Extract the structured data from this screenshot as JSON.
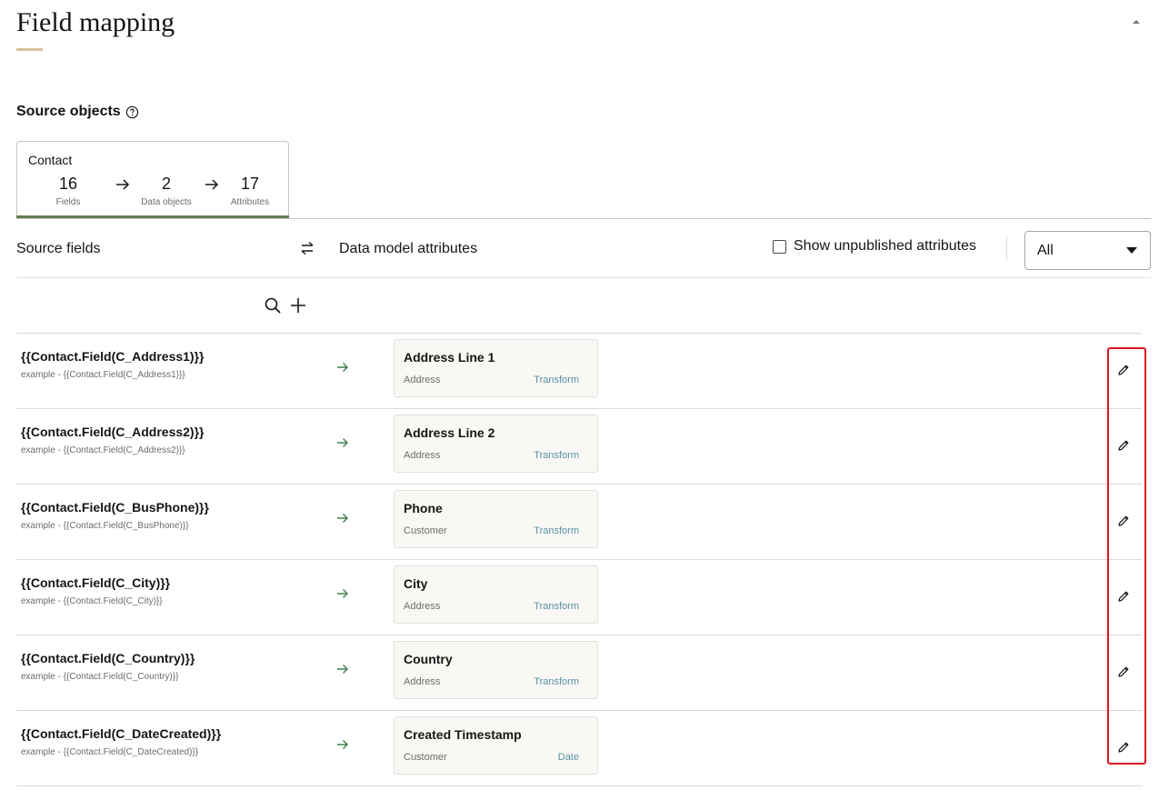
{
  "page": {
    "title": "Field mapping",
    "collapse_icon": "caret-up-icon"
  },
  "source_objects": {
    "heading": "Source objects",
    "help_icon": "help-circle-icon",
    "card": {
      "title": "Contact",
      "fields_count": "16",
      "fields_label": "Fields",
      "data_objects_count": "2",
      "data_objects_label": "Data objects",
      "attributes_count": "17",
      "attributes_label": "Attributes"
    }
  },
  "mapping_header": {
    "source_fields": "Source fields",
    "swap_icon": "swap-arrows-icon",
    "data_model_attributes": "Data model attributes",
    "show_unpublished_label": "Show unpublished attributes",
    "show_unpublished_checked": false,
    "filter_selected": "All"
  },
  "toolbar": {
    "search_icon": "search-icon",
    "add_icon": "plus-icon"
  },
  "rows": [
    {
      "field": "{{Contact.Field(C_Address1)}}",
      "example": "example - {{Contact.Field(C_Address1)}}",
      "attribute": "Address Line 1",
      "object": "Address",
      "action": "Transform"
    },
    {
      "field": "{{Contact.Field(C_Address2)}}",
      "example": "example - {{Contact.Field(C_Address2)}}",
      "attribute": "Address Line 2",
      "object": "Address",
      "action": "Transform"
    },
    {
      "field": "{{Contact.Field(C_BusPhone)}}",
      "example": "example - {{Contact.Field(C_BusPhone)}}",
      "attribute": "Phone",
      "object": "Customer",
      "action": "Transform"
    },
    {
      "field": "{{Contact.Field(C_City)}}",
      "example": "example - {{Contact.Field(C_City)}}",
      "attribute": "City",
      "object": "Address",
      "action": "Transform"
    },
    {
      "field": "{{Contact.Field(C_Country)}}",
      "example": "example - {{Contact.Field(C_Country)}}",
      "attribute": "Country",
      "object": "Address",
      "action": "Transform"
    },
    {
      "field": "{{Contact.Field(C_DateCreated)}}",
      "example": "example - {{Contact.Field(C_DateCreated)}}",
      "attribute": "Created Timestamp",
      "object": "Customer",
      "action": "Date"
    }
  ],
  "colors": {
    "accent_underline": "#d7c39b",
    "active_tab_bar": "#5f7d4f",
    "map_arrow": "#3f7f4a",
    "link": "#5a8fa6",
    "highlight": "#e0141e"
  }
}
